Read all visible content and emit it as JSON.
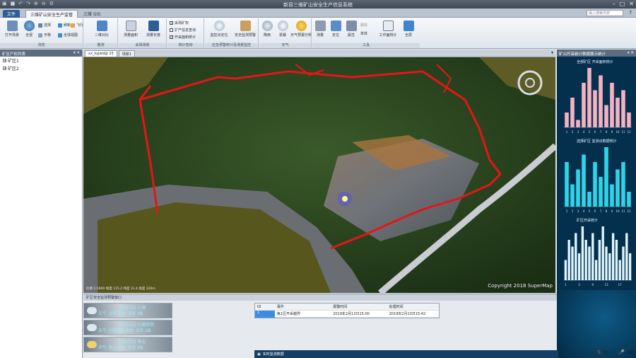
{
  "app": {
    "title": "新县三维矿山安全生产信息系统"
  },
  "tabs": {
    "file": "文件",
    "active": "三维矿山安全生产监管",
    "third": "三维 GIS"
  },
  "search": {
    "placeholder": "输入搜索内容"
  },
  "ribbon": {
    "groups": [
      {
        "label": "浏览"
      },
      {
        "label": "量测"
      },
      {
        "label": "采场场景"
      },
      {
        "label": "统计查询"
      },
      {
        "label": "应急预警统计及场景监控"
      },
      {
        "label": "天气"
      },
      {
        "label": "工具"
      }
    ],
    "buttons": {
      "open_scene": "打开场景",
      "full_view": "全视",
      "select": "选择",
      "pan": "平移",
      "refresh": "刷新",
      "fly": "飞行",
      "globe": "全球",
      "view3d": "视图",
      "tile2d": "二维对比",
      "survey_area": "测量面积",
      "survey_dist": "测量长度",
      "check_mine": "采场矿权",
      "check_query": "扩产信息查询",
      "check_stats": "开采面积统计",
      "pos_monitor": "监控点定位",
      "env_monitor": "安全监测预警",
      "rain": "降雨",
      "cloud": "雷暴",
      "weather_fc": "天气预报分析",
      "measure": "测量",
      "locate": "定位",
      "attribute": "属性",
      "delete": "删除",
      "single": "单体",
      "work_stats": "工作面统计",
      "fullscreen": "全屏"
    }
  },
  "left_panel": {
    "title": "矿区产权列表",
    "tree": [
      {
        "label": "矿区1"
      },
      {
        "label": "矿区2"
      }
    ]
  },
  "map": {
    "doc_tabs": [
      "xx_kyjwd@ 15",
      "场景1"
    ],
    "copyright": "Copyright 2018 SuperMap",
    "scale": "比例 1:5000  经度 115.2  纬度 31.4  高度 320m"
  },
  "right_panel": {
    "title": "矿山开采统计数据展示统计",
    "chart_titles": [
      "全部矿区 开采面积统计",
      "选择矿区 监测点数据统计",
      "矿区开采统计"
    ]
  },
  "bottom_panel": {
    "title": "矿区安全监测预警窗口",
    "weather": [
      {
        "date": "2月13日 小雨",
        "desc": "天气: 小雨 风向: 北风 3级"
      },
      {
        "date": "2月14日 小雨转阴",
        "desc": "天气: 小雨转阴 风向: 北风 2级"
      },
      {
        "date": "2月15日 多云",
        "desc": "天气: 多云 风向: 东风 2级"
      }
    ],
    "table": {
      "headers": [
        "ID",
        "事件",
        "报警时间",
        "处理时间"
      ],
      "rows": [
        [
          "1",
          "第1区开采越界",
          "2019年2月13日15:00",
          "2019年2月13日15:42"
        ]
      ]
    },
    "status": "实时监测数据"
  },
  "colors": {
    "accent": "#2f5e95",
    "panel_dark": "#04304e",
    "boundary": "#e41616",
    "pink_bar": "#f3b2c2",
    "cyan_bar": "#2fd3e8"
  },
  "chart_data": [
    {
      "type": "bar",
      "title": "全部矿区 开采面积统计",
      "categories": [
        "1",
        "2",
        "3",
        "4",
        "5",
        "6",
        "7",
        "8",
        "9",
        "10",
        "11",
        "12"
      ],
      "values": [
        2,
        4,
        1,
        6,
        8,
        5,
        7,
        3,
        6,
        4,
        5,
        2
      ],
      "ylim": [
        0,
        8
      ],
      "color": "#f3b2c2"
    },
    {
      "type": "bar",
      "title": "选择矿区 监测点数据统计",
      "categories": [
        "1",
        "2",
        "3",
        "4",
        "5",
        "6",
        "7",
        "8",
        "9",
        "10",
        "11",
        "12"
      ],
      "values": [
        6,
        3,
        5,
        7,
        2,
        6,
        4,
        8,
        3,
        5,
        6,
        2
      ],
      "ylim": [
        0,
        8
      ],
      "color": "#2fd3e8"
    },
    {
      "type": "bar",
      "title": "矿区开采统计",
      "categories": [
        "1",
        "2",
        "3",
        "4",
        "5",
        "6",
        "7",
        "8",
        "9",
        "10",
        "11",
        "12",
        "13",
        "14",
        "15",
        "16",
        "17",
        "18",
        "19",
        "20"
      ],
      "values": [
        3,
        6,
        5,
        7,
        4,
        8,
        6,
        5,
        7,
        3,
        6,
        8,
        5,
        4,
        7,
        6,
        3,
        5,
        7,
        4
      ],
      "ylim": [
        0,
        8
      ],
      "color": "#dff6ff"
    }
  ]
}
